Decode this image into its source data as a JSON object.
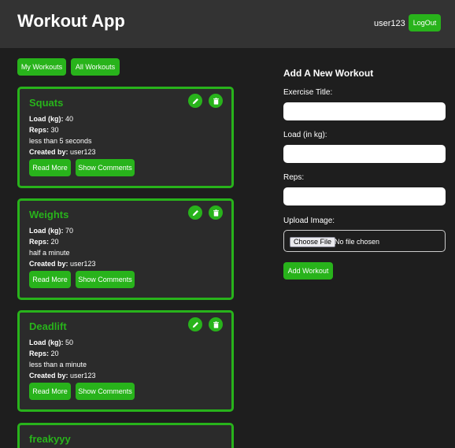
{
  "header": {
    "app_title": "Workout App",
    "username": "user123",
    "logout_label": "LogOut"
  },
  "filters": {
    "my_workouts_label": "My Workouts",
    "all_workouts_label": "All Workouts"
  },
  "workouts": [
    {
      "title": "Squats",
      "load_label": "Load (kg):",
      "load": " 40",
      "reps_label": "Reps:",
      "reps": " 30",
      "description": "less than 5 seconds",
      "created_label": "Created by:",
      "created_by": " user123",
      "read_more_label": "Read More",
      "comments_label": "Show Comments"
    },
    {
      "title": "Weights",
      "load_label": "Load (kg):",
      "load": " 70",
      "reps_label": "Reps:",
      "reps": " 20",
      "description": "half a minute",
      "created_label": "Created by:",
      "created_by": " user123",
      "read_more_label": "Read More",
      "comments_label": "Show Comments"
    },
    {
      "title": "Deadlift",
      "load_label": "Load (kg):",
      "load": " 50",
      "reps_label": "Reps:",
      "reps": " 20",
      "description": "less than a minute",
      "created_label": "Created by:",
      "created_by": " user123",
      "read_more_label": "Read More",
      "comments_label": "Show Comments"
    },
    {
      "title": "freakyyy"
    }
  ],
  "form": {
    "heading": "Add A New Workout",
    "title_label": "Exercise Title:",
    "title_value": "",
    "load_label": "Load (in kg):",
    "load_value": "",
    "reps_label": "Reps:",
    "reps_value": "",
    "image_label": "Upload Image:",
    "choose_file_label": "Choose File",
    "no_file_text": "No file chosen",
    "submit_label": "Add Workout"
  },
  "icons": {
    "edit": "pencil-icon",
    "delete": "trash-icon"
  },
  "colors": {
    "accent": "#28b31b",
    "background": "#1e1e1e",
    "header": "#333333",
    "card": "#2b2b2b"
  }
}
